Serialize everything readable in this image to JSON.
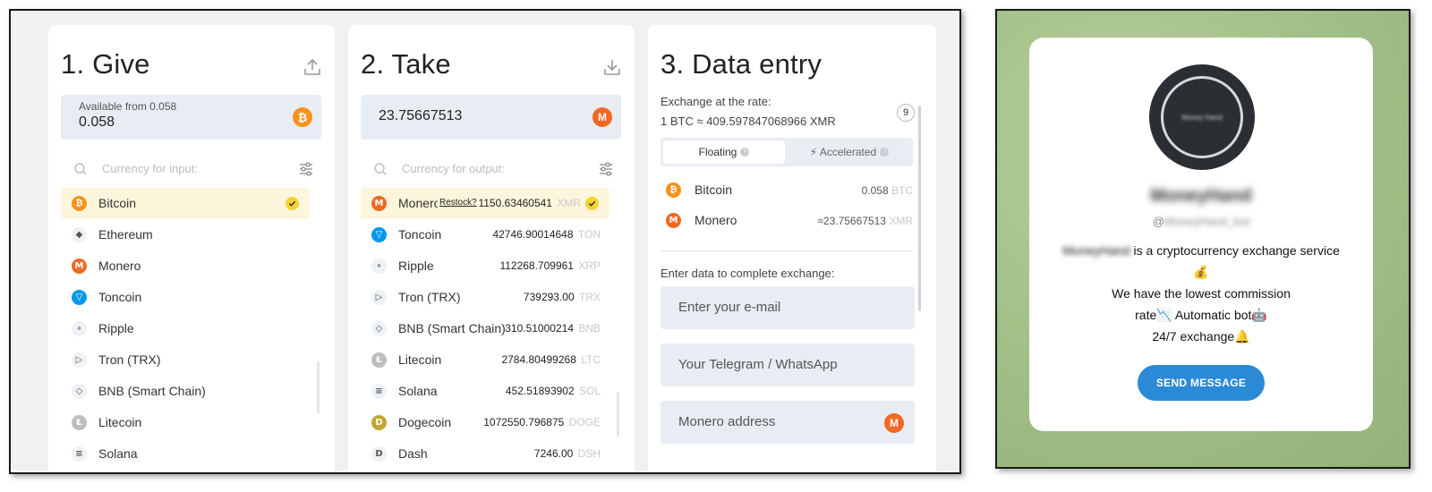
{
  "give": {
    "title": "1. Give",
    "available_label": "Available from 0.058",
    "amount": "0.058",
    "search_placeholder": "Currency for input:",
    "coins": [
      {
        "name": "Bitcoin",
        "icon": "bitcoin-icon",
        "color": "#f7931a",
        "glyph": "₿",
        "selected": true
      },
      {
        "name": "Ethereum",
        "icon": "ethereum-icon",
        "color": "#ffffff",
        "glyph": "◆"
      },
      {
        "name": "Monero",
        "icon": "monero-icon",
        "color": "#f26822",
        "glyph": "M"
      },
      {
        "name": "Toncoin",
        "icon": "toncoin-icon",
        "color": "#0098ea",
        "glyph": "▽"
      },
      {
        "name": "Ripple",
        "icon": "ripple-icon",
        "color": "#ffffff",
        "glyph": "∘"
      },
      {
        "name": "Tron (TRX)",
        "icon": "tron-icon",
        "color": "#ffffff",
        "glyph": "▷"
      },
      {
        "name": "BNB (Smart Chain)",
        "icon": "bnb-icon",
        "color": "#ffffff",
        "glyph": "◇"
      },
      {
        "name": "Litecoin",
        "icon": "litecoin-icon",
        "color": "#bebebe",
        "glyph": "Ł"
      },
      {
        "name": "Solana",
        "icon": "solana-icon",
        "color": "#ffffff",
        "glyph": "≡"
      }
    ]
  },
  "take": {
    "title": "2. Take",
    "amount": "23.75667513",
    "search_placeholder": "Currency for output:",
    "restock_label": "Restock?",
    "coins": [
      {
        "name": "Monero",
        "rate": "1150.63460541",
        "ticker": "XMR",
        "icon": "monero-icon",
        "color": "#f26822",
        "glyph": "M",
        "selected": true
      },
      {
        "name": "Toncoin",
        "rate": "42746.90014648",
        "ticker": "TON",
        "icon": "toncoin-icon",
        "color": "#0098ea",
        "glyph": "▽"
      },
      {
        "name": "Ripple",
        "rate": "112268.709961",
        "ticker": "XRP",
        "icon": "ripple-icon",
        "color": "#ffffff",
        "glyph": "∘"
      },
      {
        "name": "Tron (TRX)",
        "rate": "739293.00",
        "ticker": "TRX",
        "icon": "tron-icon",
        "color": "#ffffff",
        "glyph": "▷"
      },
      {
        "name": "BNB (Smart Chain)",
        "rate": "310.51000214",
        "ticker": "BNB",
        "icon": "bnb-icon",
        "color": "#ffffff",
        "glyph": "◇"
      },
      {
        "name": "Litecoin",
        "rate": "2784.80499268",
        "ticker": "LTC",
        "icon": "litecoin-icon",
        "color": "#bebebe",
        "glyph": "Ł"
      },
      {
        "name": "Solana",
        "rate": "452.51893902",
        "ticker": "SOL",
        "icon": "solana-icon",
        "color": "#ffffff",
        "glyph": "≡"
      },
      {
        "name": "Dogecoin",
        "rate": "1072550.796875",
        "ticker": "DOGE",
        "icon": "dogecoin-icon",
        "color": "#c2a633",
        "glyph": "D"
      },
      {
        "name": "Dash",
        "rate": "7246.00",
        "ticker": "DSH",
        "icon": "dash-icon",
        "color": "#ffffff",
        "glyph": "D"
      }
    ]
  },
  "data_entry": {
    "title": "3. Data entry",
    "rate_label": "Exchange at the rate:",
    "rate_value": "1 BTC ≈ 409.597847068966 XMR",
    "timer": "9",
    "mode_floating": "Floating",
    "mode_accelerated": "⚡ Accelerated",
    "summary": [
      {
        "name": "Bitcoin",
        "amount": "0.058",
        "ticker": "BTC",
        "color": "#f7931a",
        "glyph": "₿"
      },
      {
        "name": "Monero",
        "amount": "≈23.75667513",
        "ticker": "XMR",
        "color": "#f26822",
        "glyph": "M"
      }
    ],
    "enter_label": "Enter data to complete exchange:",
    "email_placeholder": "Enter your e-mail",
    "contact_placeholder": "Your Telegram / WhatsApp",
    "address_placeholder": "Monero address"
  },
  "telegram": {
    "bot_name": "MoneyHand",
    "handle_prefix": "@",
    "handle_blurred": "MoneyHand_bot",
    "avatar_text": "Money Hand",
    "desc_blurred_name": "MoneyHand",
    "desc_line1": " is a cryptocurrency exchange service",
    "desc_line2": "💰",
    "desc_line3": "We have the lowest commission",
    "desc_line4": "rate📉 Automatic bot🤖",
    "desc_line5": "24/7 exchange🔔",
    "send_button": "SEND MESSAGE"
  },
  "colors": {
    "accent_blue": "#2a8ad6",
    "selected_row": "#fdf6dc",
    "check_yellow": "#f5d330",
    "field_bg": "#e8edf3"
  }
}
